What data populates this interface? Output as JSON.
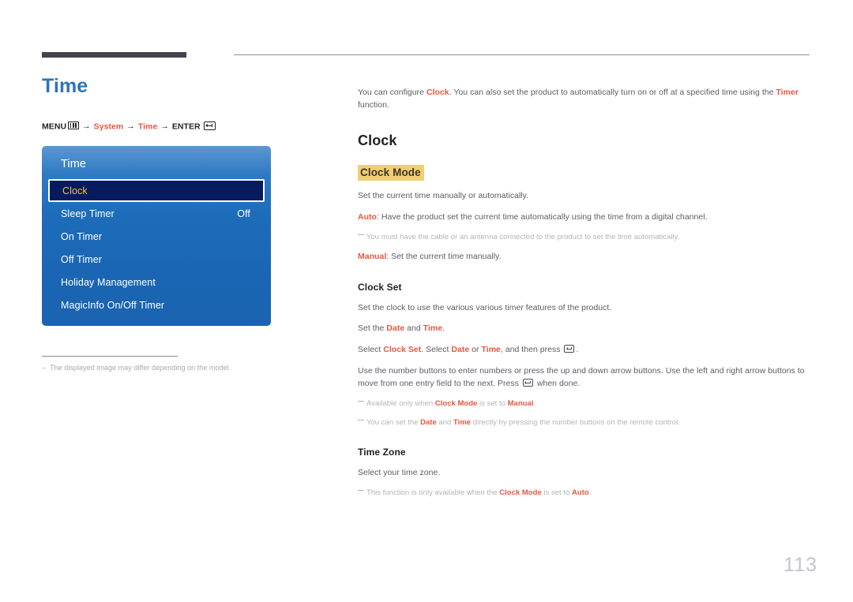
{
  "page": {
    "number": "113"
  },
  "left": {
    "title": "Time",
    "menu_path": {
      "menu_label": "MENU",
      "menu_icon": "menu-grid-icon",
      "arrow1": "→",
      "system_label": "System",
      "arrow2": "→",
      "time_label": "Time",
      "arrow3": "→",
      "enter_label": "ENTER",
      "enter_icon": "enter-key-icon"
    },
    "osd": {
      "title": "Time",
      "items": [
        {
          "label": "Clock",
          "value": "",
          "selected": true
        },
        {
          "label": "Sleep Timer",
          "value": "Off",
          "selected": false
        },
        {
          "label": "On Timer",
          "value": "",
          "selected": false
        },
        {
          "label": "Off Timer",
          "value": "",
          "selected": false
        },
        {
          "label": "Holiday Management",
          "value": "",
          "selected": false
        },
        {
          "label": "MagicInfo On/Off Timer",
          "value": "",
          "selected": false
        }
      ]
    },
    "footnote": {
      "dash": "–",
      "text": "The displayed image may differ depending on the model."
    }
  },
  "right": {
    "intro": {
      "part1": "You can configure ",
      "bold1": "Clock",
      "part2": ". You can also set the product to automatically turn on or off at a specified time using the ",
      "bold2": "Timer",
      "part3": " function."
    },
    "heading_clock": "Clock",
    "clock_mode": {
      "heading": "Clock Mode",
      "desc": "Set the current time manually or automatically.",
      "auto_label": "Auto",
      "auto_desc": ": Have the product set the current time automatically using the time from a digital channel.",
      "auto_note": "You must have the cable or an antenna connected to the product to set the time automatically.",
      "manual_label": "Manual",
      "manual_desc": ": Set the current time manually."
    },
    "clock_set": {
      "heading": "Clock Set",
      "line1": "Set the clock to use the various various timer features of the product.",
      "line2_a": "Set the ",
      "line2_b": "Date",
      "line2_c": " and ",
      "line2_d": "Time",
      "line2_e": ".",
      "line3_a": "Select ",
      "line3_b": "Clock Set",
      "line3_c": ". Select ",
      "line3_d": "Date",
      "line3_e": " or ",
      "line3_f": "Time",
      "line3_g": ", and then press ",
      "line3_h": ".",
      "line4_a": "Use the number buttons to enter numbers or press the up and down arrow buttons. Use the left and right arrow buttons to move from one entry field to the next. Press ",
      "line4_b": " when done.",
      "note1_a": "Available only when ",
      "note1_b": "Clock Mode",
      "note1_c": " is set to ",
      "note1_d": "Manual",
      "note1_e": ".",
      "note2_a": "You can set the ",
      "note2_b": "Date",
      "note2_c": " and ",
      "note2_d": "Time",
      "note2_e": " directly by pressing the number buttons on the remote control."
    },
    "time_zone": {
      "heading": "Time Zone",
      "desc": "Select your time zone.",
      "note_a": "This function is only available when the ",
      "note_b": "Clock Mode",
      "note_c": " is set to ",
      "note_d": "Auto",
      "note_e": "."
    }
  },
  "colors": {
    "title_blue": "#2e75b6",
    "accent_orange": "#e8573f",
    "highlight_gold": "#f0cf72",
    "osd_blue": "#1d6cba",
    "osd_selected": "#061a5e",
    "osd_selected_text": "#f5c342",
    "body_text": "#5c5c66",
    "note_text": "#b3b3bd",
    "header_bar": "#45424f",
    "page_number": "#c3c3d2"
  }
}
